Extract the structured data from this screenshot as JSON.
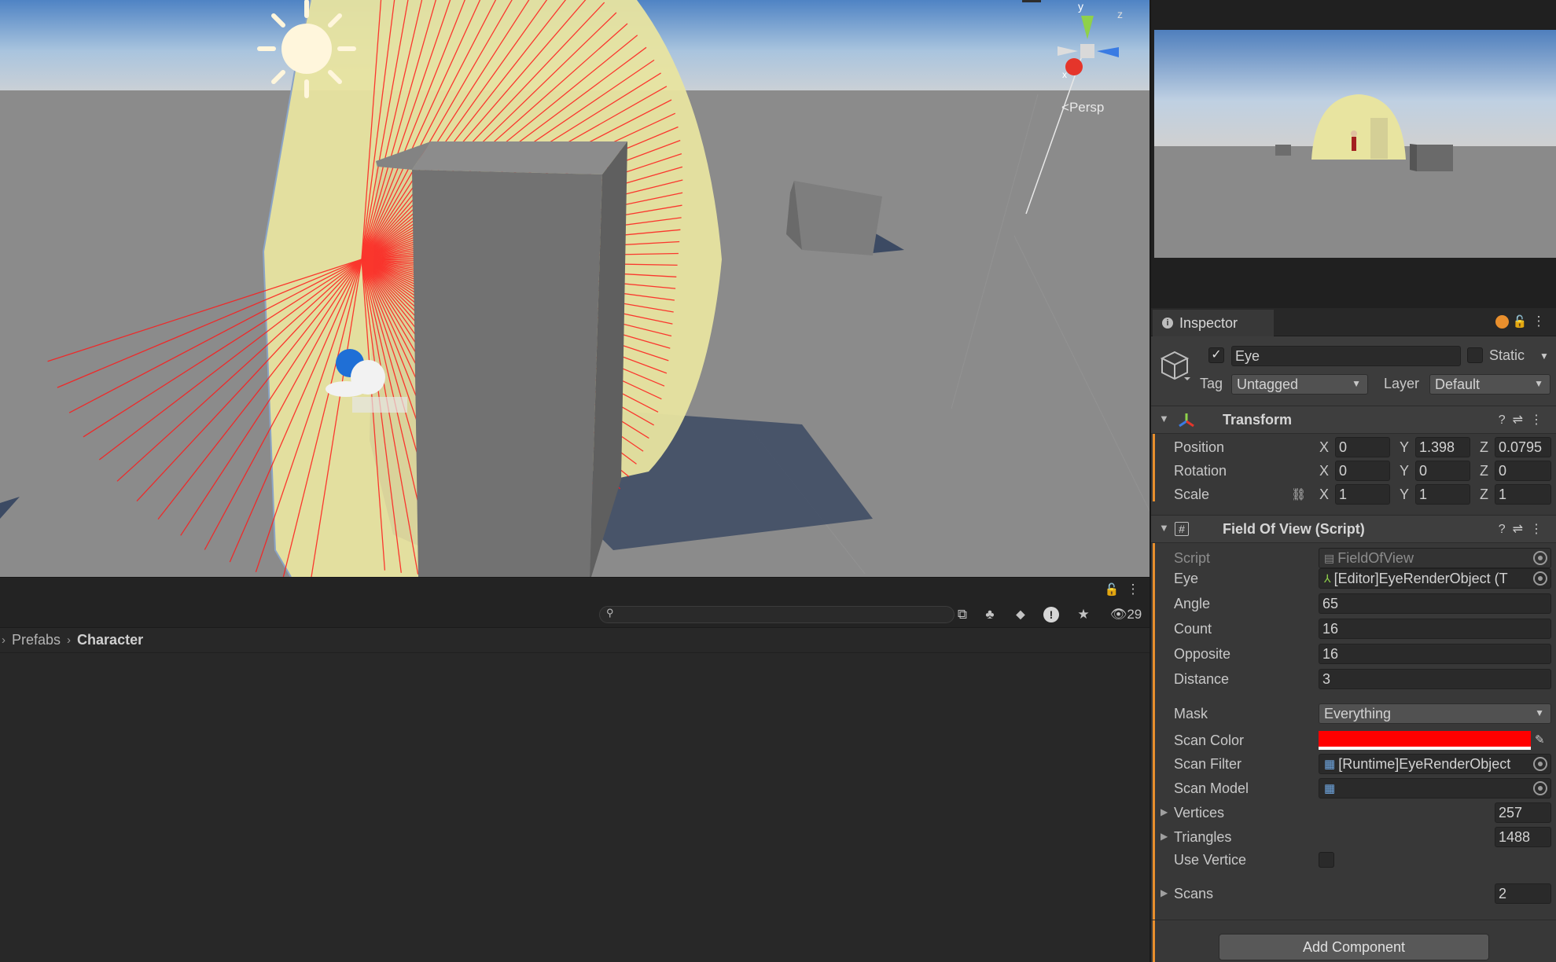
{
  "scene": {
    "view_label": "Persp",
    "gizmo": {
      "y": "y",
      "z": "z",
      "x": "x"
    }
  },
  "project": {
    "breadcrumb": [
      "Prefabs",
      "Character"
    ],
    "hidden_count": "29"
  },
  "inspector": {
    "tab_label": "Inspector",
    "object_name": "Eye",
    "static_label": "Static",
    "tag_label": "Tag",
    "tag_value": "Untagged",
    "layer_label": "Layer",
    "layer_value": "Default",
    "transform": {
      "title": "Transform",
      "position": {
        "label": "Position",
        "x": "0",
        "y": "1.398",
        "z": "0.0795"
      },
      "rotation": {
        "label": "Rotation",
        "x": "0",
        "y": "0",
        "z": "0"
      },
      "scale": {
        "label": "Scale",
        "x": "1",
        "y": "1",
        "z": "1"
      }
    },
    "fov": {
      "title": "Field Of View (Script)",
      "script_label": "Script",
      "script_value": "FieldOfView",
      "eye_label": "Eye",
      "eye_value": "[Editor]EyeRenderObject (T",
      "angle_label": "Angle",
      "angle_value": "65",
      "count_label": "Count",
      "count_value": "16",
      "opposite_label": "Opposite",
      "opposite_value": "16",
      "distance_label": "Distance",
      "distance_value": "3",
      "mask_label": "Mask",
      "mask_value": "Everything",
      "scan_color_label": "Scan Color",
      "scan_color": "#ff0000",
      "scan_filter_label": "Scan Filter",
      "scan_filter_value": "[Runtime]EyeRenderObject",
      "scan_model_label": "Scan Model",
      "vertices_label": "Vertices",
      "vertices_value": "257",
      "triangles_label": "Triangles",
      "triangles_value": "1488",
      "use_vertice_label": "Use Vertice",
      "scans_label": "Scans",
      "scans_value": "2"
    },
    "add_component": "Add Component"
  },
  "colors": {
    "accent": "#e98f2d",
    "scan": "#ff0000",
    "fov_fill": "#e8e4a0"
  }
}
